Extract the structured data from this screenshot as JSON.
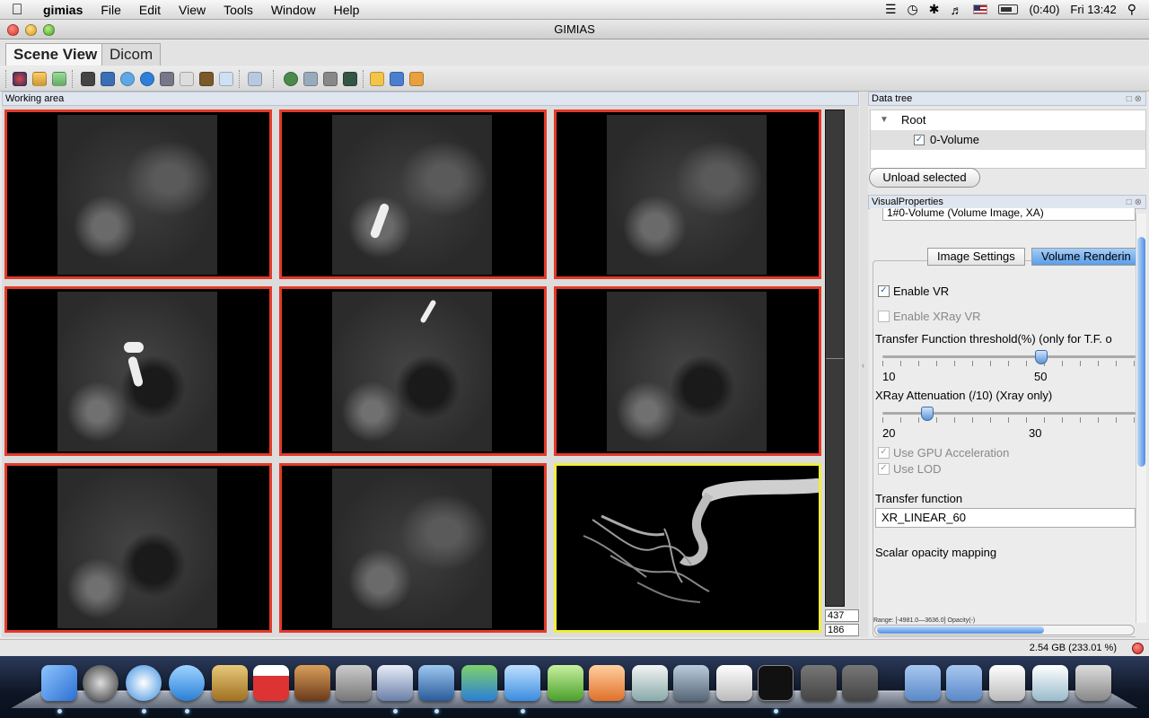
{
  "menubar": {
    "app_name": "gimias",
    "items": [
      "File",
      "Edit",
      "View",
      "Tools",
      "Window",
      "Help"
    ],
    "battery": "(0:40)",
    "clock": "Fri 13:42"
  },
  "window": {
    "title": "GIMIAS"
  },
  "tabs": [
    {
      "label": "Scene View",
      "active": true
    },
    {
      "label": "Dicom",
      "active": false
    }
  ],
  "working_area": {
    "title": "Working area",
    "spin_top": "437",
    "spin_bottom": "186"
  },
  "data_tree": {
    "title": "Data tree",
    "root_label": "Root",
    "item_label": "0-Volume",
    "unload_button": "Unload selected"
  },
  "visual_properties": {
    "title": "VisualProperties",
    "combo_value": "1#0-Volume (Volume Image, XA)",
    "tabs": [
      "Image Settings",
      "Volume Renderin"
    ],
    "enable_vr": "Enable VR",
    "enable_xray": "Enable XRay VR",
    "tf_threshold_label": "Transfer Function threshold(%) (only for T.F. o",
    "tf_min": "10",
    "tf_value": "50",
    "xray_label": "XRay Attenuation (/10) (Xray only)",
    "xray_min": "20",
    "xray_value": "30",
    "gpu_label": "Use GPU Acceleration",
    "lod_label": "Use LOD",
    "transfer_function_label": "Transfer function",
    "transfer_function_value": "XR_LINEAR_60",
    "scalar_opacity_label": "Scalar opacity mapping",
    "range_text": "Range: [-4981.0—3636.0] Opacity(-)"
  },
  "status": {
    "memory": "2.54 GB (233.01 %)"
  },
  "colors": {
    "view_border": "#e23a2a",
    "selected_view_border": "#f1ee3a",
    "accent": "#5a9de8"
  }
}
